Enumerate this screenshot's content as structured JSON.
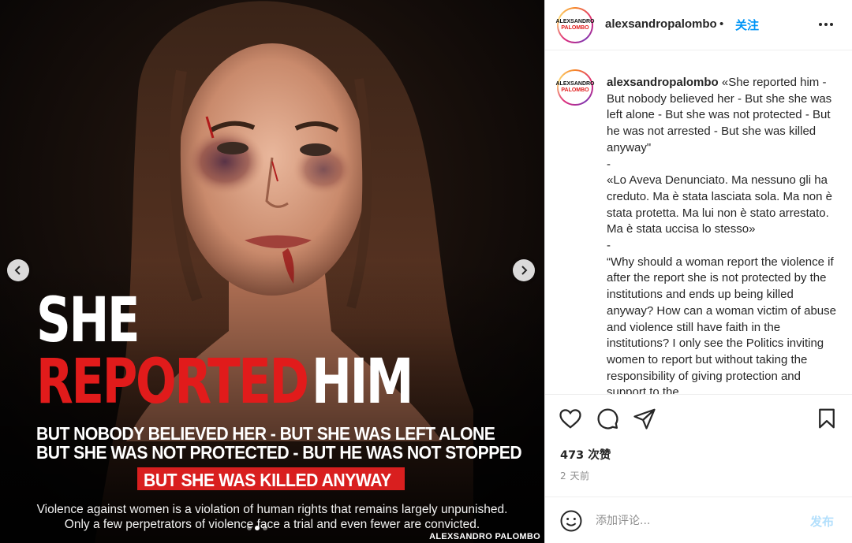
{
  "media": {
    "headline_line1": "SHE",
    "headline_line2_red": "REPORTED",
    "headline_line2_white": "HIM",
    "subline1": "BUT NOBODY BELIEVED HER - BUT SHE WAS LEFT ALONE",
    "subline2": "BUT SHE WAS NOT PROTECTED - BUT HE WAS NOT STOPPED",
    "highlight": "BUT SHE WAS KILLED ANYWAY",
    "caption1": "Violence against women is a violation of human rights that remains largely unpunished.",
    "caption2": "Only a few perpetrators of violence face a trial and even fewer are convicted.",
    "watermark": "ALEXSANDRO PALOMBO",
    "accent_red": "#e11b1b",
    "carousel_dots": 3,
    "active_dot": 2,
    "prev_icon": "chevron-left-icon",
    "next_icon": "chevron-right-icon"
  },
  "header": {
    "avatar_logo_top": "ALEXSANDRO",
    "avatar_logo_bottom": "PALOMBO",
    "username": "alexsandropalombo",
    "separator": "•",
    "follow_label": "关注",
    "more_icon": "more-horizontal-icon"
  },
  "comment": {
    "username": "alexsandropalombo",
    "paragraphs": [
      "«She reported him - But nobody believed her - But she she was left alone - But she was not protected - But he was not arrested - But she was killed anyway\"",
      "-",
      "«Lo Aveva Denunciato. Ma nessuno gli ha creduto. Ma è stata lasciata sola. Ma non è stata protetta. Ma lui non è stato arrestato. Ma è stata uccisa lo stesso»",
      "-",
      "“Why should a woman report the violence if after the report she is not protected by the institutions and ends up being killed anyway? How can a woman victim of abuse and violence still have faith in the institutions? I only see the Politics inviting women to report but without taking the responsibility of giving protection and support to the"
    ]
  },
  "actions": {
    "like_icon": "heart-icon",
    "comment_icon": "comment-bubble-icon",
    "share_icon": "paper-plane-icon",
    "save_icon": "bookmark-icon",
    "likes_text": "473 次赞",
    "time_text": "2 天前"
  },
  "add_comment": {
    "emoji_icon": "emoji-smile-icon",
    "placeholder": "添加评论...",
    "post_label": "发布",
    "post_color": "#b2dffc"
  }
}
